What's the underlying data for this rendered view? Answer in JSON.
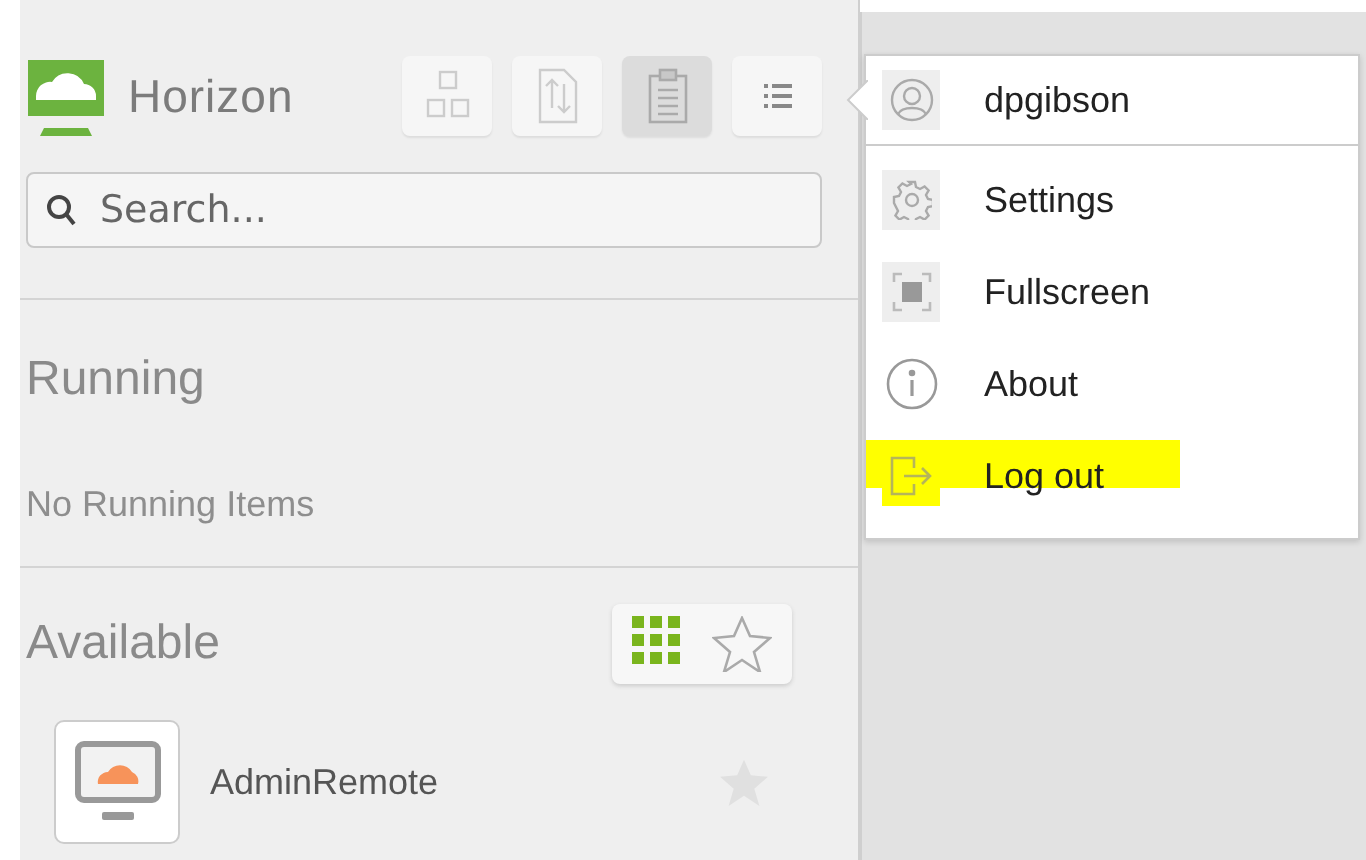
{
  "sidebar": {
    "logo": {
      "text": "Horizon"
    },
    "toolbar": [
      {
        "kind": "apps",
        "selected": false
      },
      {
        "kind": "transfer",
        "selected": false
      },
      {
        "kind": "clipboard",
        "selected": true
      },
      {
        "kind": "menu",
        "selected": false
      }
    ],
    "search": {
      "placeholder": "Search..."
    },
    "running": {
      "heading": "Running",
      "empty_text": "No Running Items"
    },
    "available": {
      "heading": "Available",
      "view_toggles": [
        {
          "kind": "grid",
          "selected": true
        },
        {
          "kind": "favorites",
          "selected": false
        }
      ],
      "items": [
        {
          "name": "AdminRemote",
          "favorite": false
        }
      ]
    }
  },
  "menu": {
    "user": "dpgibson",
    "items": [
      {
        "kind": "settings",
        "label": "Settings",
        "highlighted": false
      },
      {
        "kind": "fullscreen",
        "label": "Fullscreen",
        "highlighted": false
      },
      {
        "kind": "about",
        "label": "About",
        "highlighted": false
      },
      {
        "kind": "logout",
        "label": "Log out",
        "highlighted": true
      }
    ]
  }
}
